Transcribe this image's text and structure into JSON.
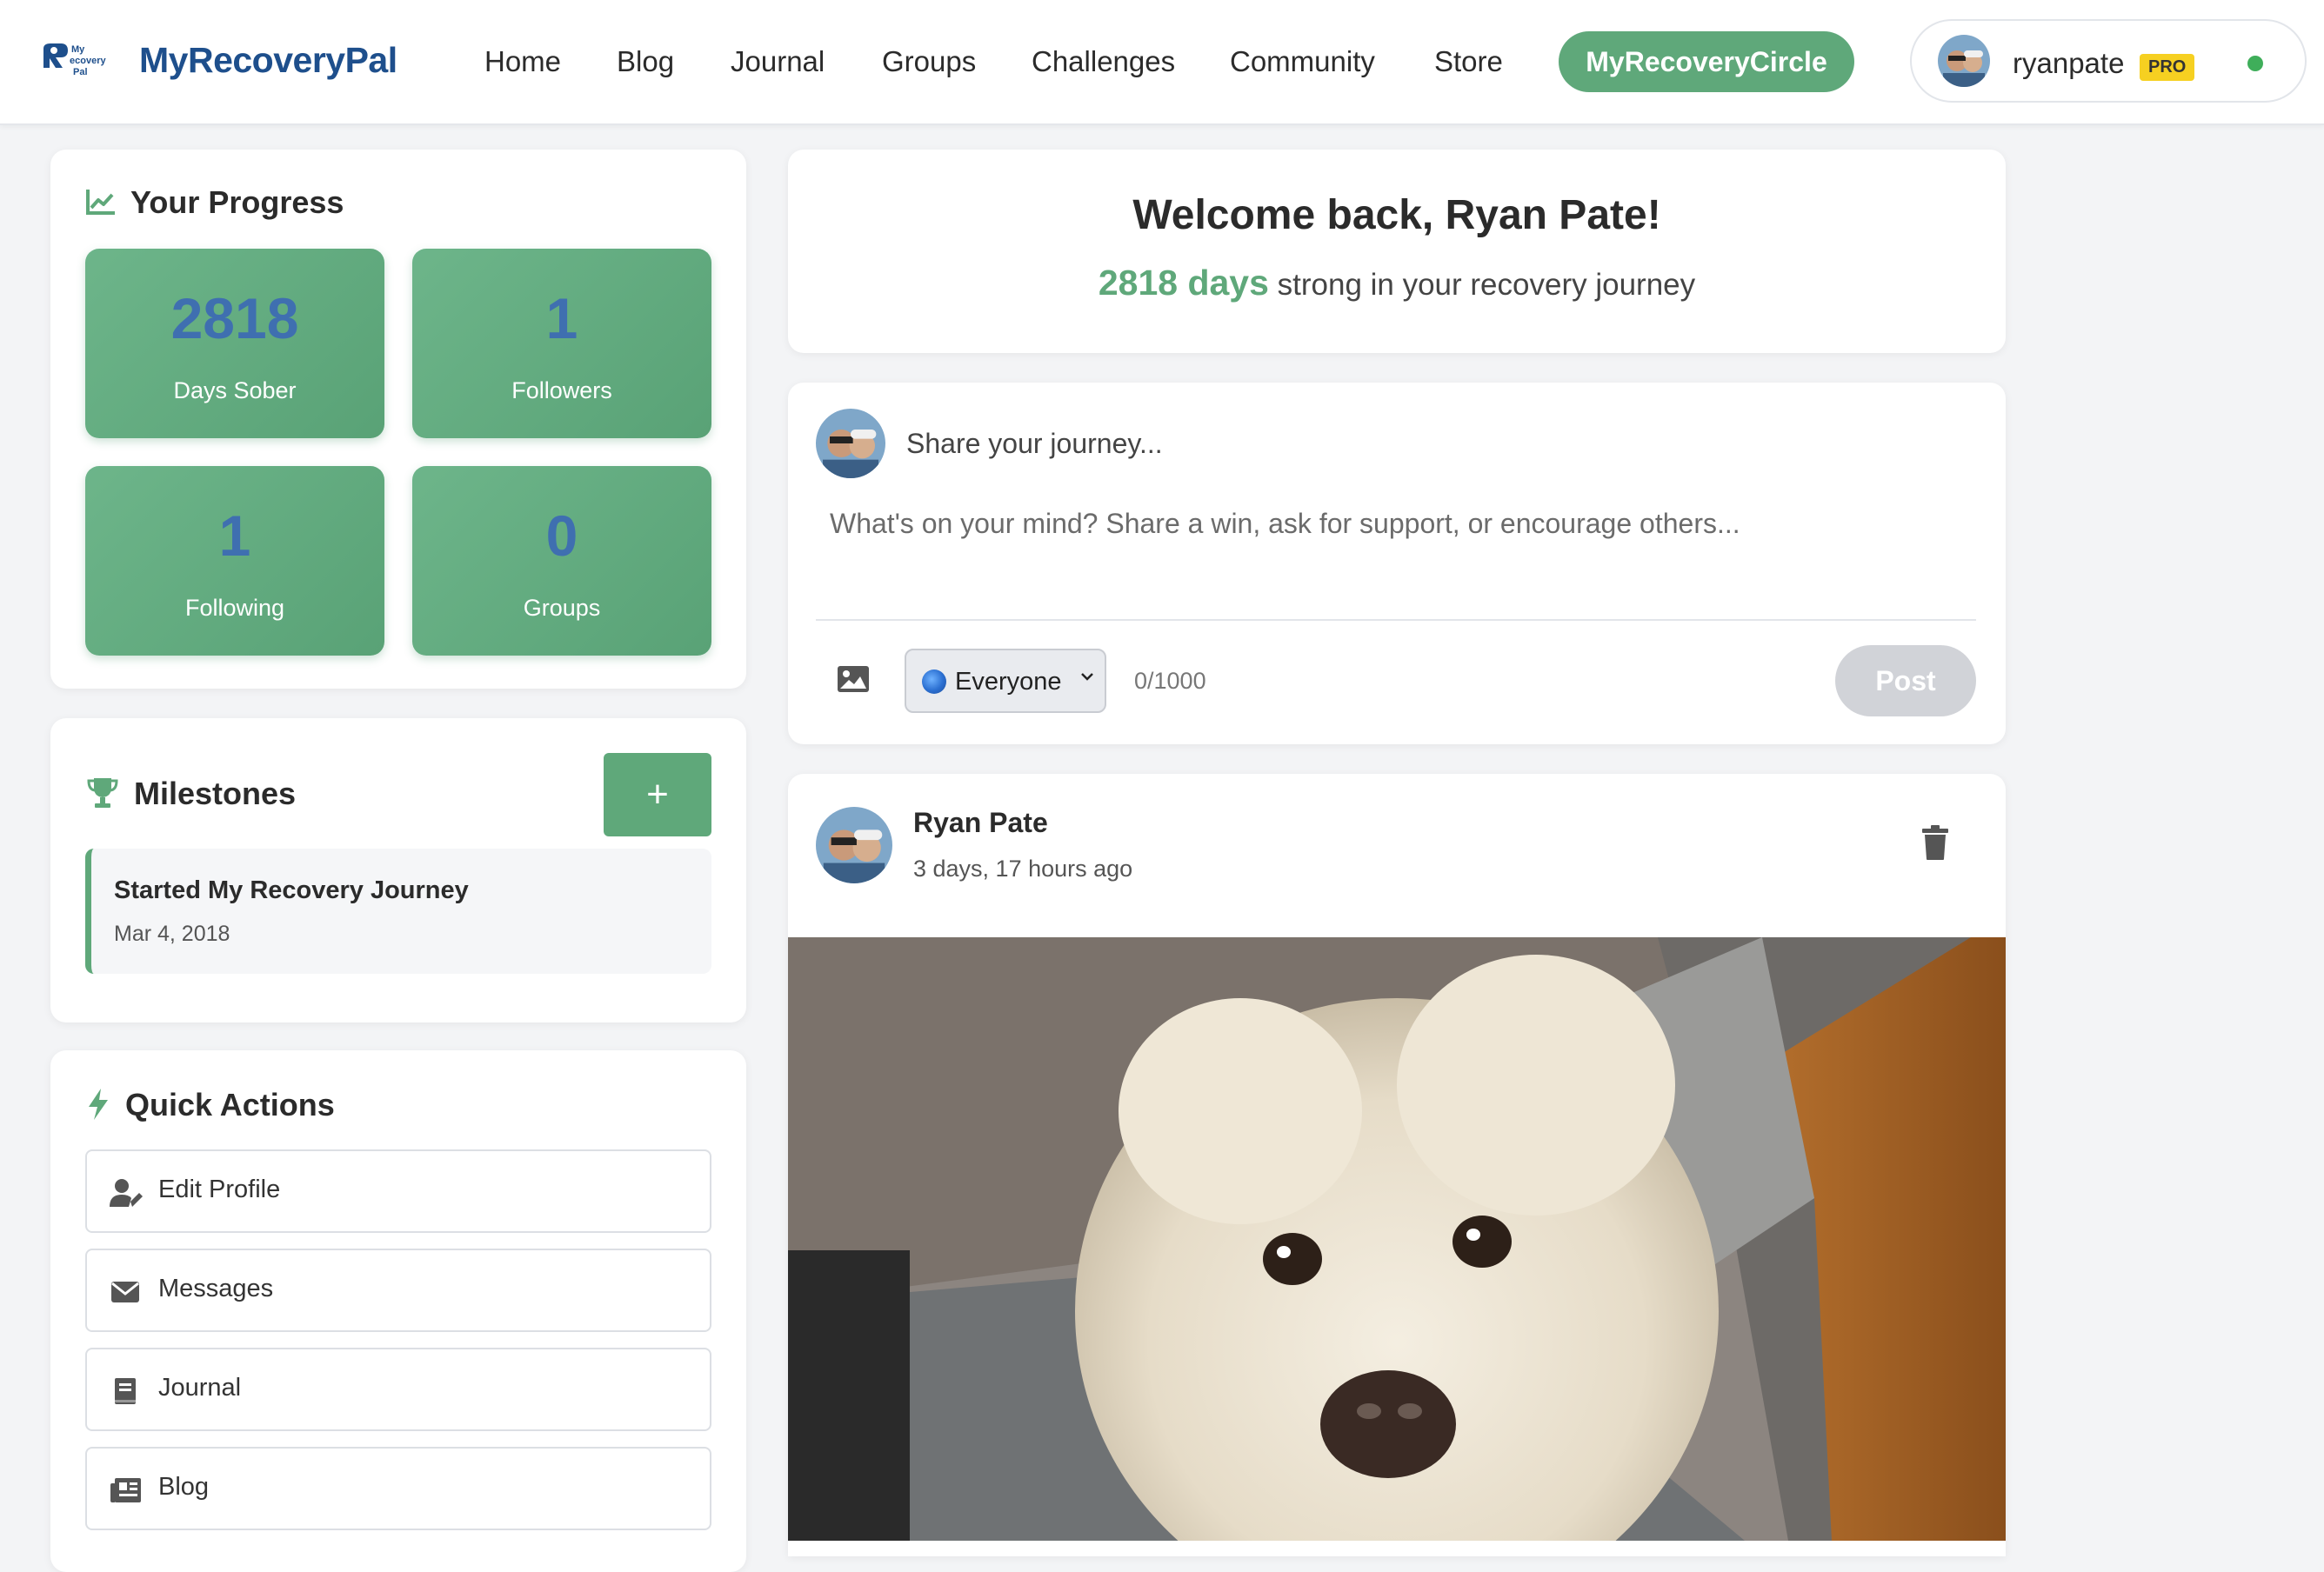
{
  "app": {
    "brand": "MyRecoveryPal",
    "logo_text": "My Recovery Pal"
  },
  "nav": {
    "items": [
      "Home",
      "Blog",
      "Journal",
      "Groups",
      "Challenges",
      "Community",
      "Store"
    ],
    "cta": "MyRecoveryCircle"
  },
  "user": {
    "username": "ryanpate",
    "badge": "PRO",
    "status": "online"
  },
  "progress": {
    "title": "Your Progress",
    "stats": [
      {
        "value": "2818",
        "label": "Days Sober"
      },
      {
        "value": "1",
        "label": "Followers"
      },
      {
        "value": "1",
        "label": "Following"
      },
      {
        "value": "0",
        "label": "Groups"
      }
    ]
  },
  "milestones": {
    "title": "Milestones",
    "add_label": "+",
    "items": [
      {
        "title": "Started My Recovery Journey",
        "date": "Mar 4, 2018"
      }
    ]
  },
  "quick_actions": {
    "title": "Quick Actions",
    "items": [
      {
        "label": "Edit Profile",
        "icon": "user-edit-icon"
      },
      {
        "label": "Messages",
        "icon": "envelope-icon"
      },
      {
        "label": "Journal",
        "icon": "book-icon"
      },
      {
        "label": "Blog",
        "icon": "newspaper-icon"
      }
    ]
  },
  "welcome": {
    "title": "Welcome back, Ryan Pate!",
    "days": "2818 days",
    "subtitle_rest": " strong in your recovery journey"
  },
  "composer": {
    "prompt": "Share your journey...",
    "placeholder": "What's on your mind? Share a win, ask for support, or encourage others...",
    "audience": "Everyone",
    "char_count": "0/1000",
    "post_label": "Post"
  },
  "post": {
    "author": "Ryan Pate",
    "time": "3 days, 17 hours ago",
    "image": "dog-photo"
  },
  "colors": {
    "accent": "#5fa87a",
    "brand": "#1e4f8c",
    "stat_number": "#3f6fb0",
    "pro_badge": "#f6d021"
  }
}
